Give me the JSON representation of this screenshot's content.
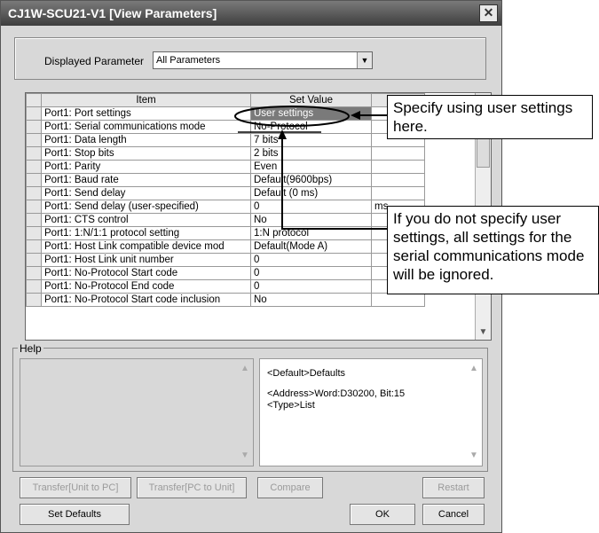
{
  "window": {
    "title": "CJ1W-SCU21-V1 [View Parameters]",
    "close_glyph": "✕"
  },
  "displayed": {
    "label": "Displayed Parameter",
    "value": "All Parameters"
  },
  "table": {
    "headers": [
      "Item",
      "Set Value"
    ],
    "rows": [
      {
        "item": "Port1: Port settings",
        "value": "User settings",
        "unit": ""
      },
      {
        "item": "Port1: Serial communications mode",
        "value": "No-Protocol",
        "unit": ""
      },
      {
        "item": "Port1: Data length",
        "value": "7 bits",
        "unit": ""
      },
      {
        "item": "Port1: Stop bits",
        "value": "2 bits",
        "unit": ""
      },
      {
        "item": "Port1: Parity",
        "value": "Even",
        "unit": ""
      },
      {
        "item": "Port1: Baud rate",
        "value": "Default(9600bps)",
        "unit": ""
      },
      {
        "item": "Port1: Send delay",
        "value": "Default (0 ms)",
        "unit": ""
      },
      {
        "item": "Port1: Send delay (user-specified)",
        "value": "0",
        "unit": "ms"
      },
      {
        "item": "Port1: CTS control",
        "value": "No",
        "unit": ""
      },
      {
        "item": "Port1: 1:N/1:1 protocol setting",
        "value": "1:N protocol",
        "unit": ""
      },
      {
        "item": "Port1: Host Link compatible device mod",
        "value": "Default(Mode A)",
        "unit": ""
      },
      {
        "item": "Port1: Host Link unit number",
        "value": "0",
        "unit": ""
      },
      {
        "item": "Port1: No-Protocol Start code",
        "value": "0",
        "unit": ""
      },
      {
        "item": "Port1: No-Protocol End code",
        "value": "0",
        "unit": ""
      },
      {
        "item": "Port1: No-Protocol Start code inclusion",
        "value": "No",
        "unit": ""
      }
    ]
  },
  "help": {
    "label": "Help",
    "line1": "<Default>Defaults",
    "line2": "<Address>Word:D30200, Bit:15",
    "line3": "<Type>List"
  },
  "buttons": {
    "transfer_to_pc": "Transfer[Unit to PC]",
    "transfer_to_unit": "Transfer[PC to Unit]",
    "compare": "Compare",
    "restart": "Restart",
    "set_defaults": "Set Defaults",
    "ok": "OK",
    "cancel": "Cancel"
  },
  "callouts": {
    "specify": "Specify using user settings here.",
    "ignore": "If you do not specify user settings, all settings for the serial communications mode will be ignored."
  }
}
